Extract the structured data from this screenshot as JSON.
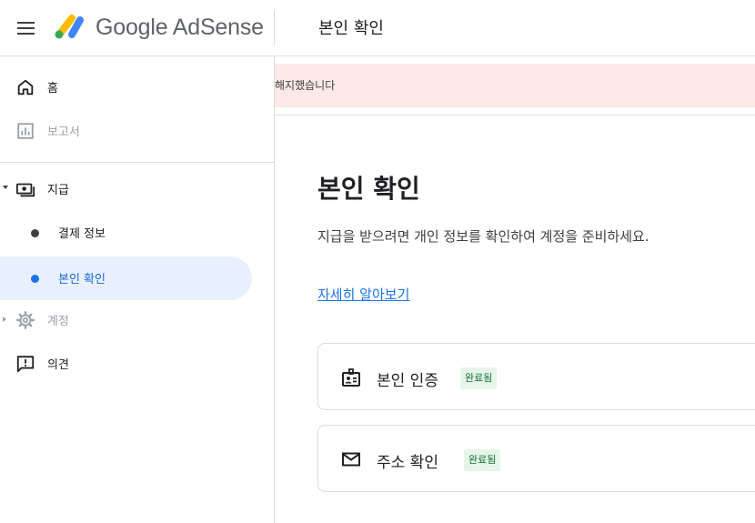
{
  "header": {
    "brand": "Google AdSense",
    "page_title": "본인 확인"
  },
  "sidebar": {
    "items": [
      {
        "label": "홈",
        "icon": "home-icon"
      },
      {
        "label": "보고서",
        "icon": "bar-chart-icon",
        "disabled": true
      },
      {
        "label": "지급",
        "icon": "payments-icon",
        "expanded": true
      },
      {
        "label": "결제 정보"
      },
      {
        "label": "본인 확인",
        "active": true
      },
      {
        "label": "계정",
        "icon": "gear-icon",
        "disabled": true,
        "collapsed": true
      },
      {
        "label": "의견",
        "icon": "feedback-icon"
      }
    ]
  },
  "banner": {
    "text": "해지했습니다"
  },
  "main": {
    "heading": "본인 확인",
    "description": "지급을 받으려면 개인 정보를 확인하여 계정을 준비하세요.",
    "learn_more": "자세히 알아보기",
    "cards": [
      {
        "label": "본인 인증",
        "status": "완료됨",
        "icon": "id-badge-icon"
      },
      {
        "label": "주소 확인",
        "status": "완료됨",
        "icon": "mail-icon"
      }
    ]
  },
  "colors": {
    "accent": "#1a73e8",
    "active_bg": "#e8f0fe",
    "banner_bg": "#fce8e6",
    "badge_bg": "#e6f4ea",
    "badge_text": "#137333"
  }
}
